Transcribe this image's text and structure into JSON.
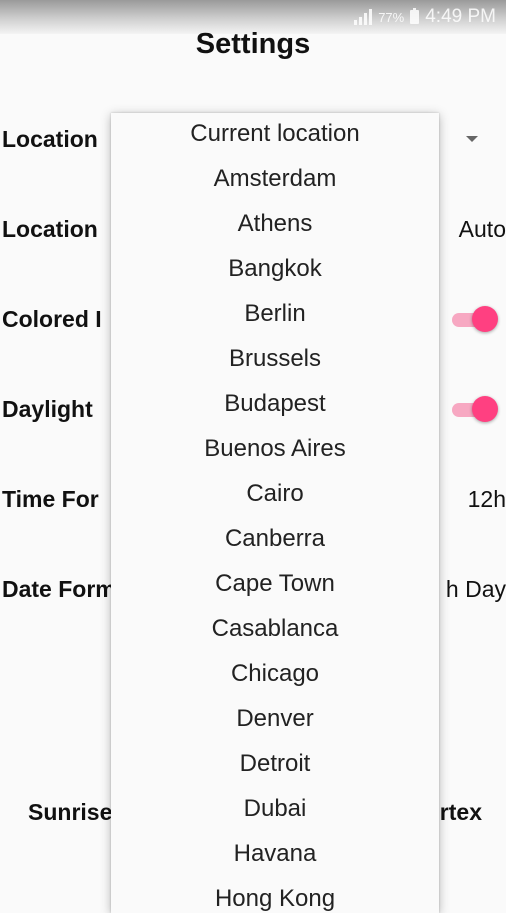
{
  "status_bar": {
    "battery_percent": "77%",
    "time": "4:49 PM",
    "icons": [
      "signal-icon",
      "battery-icon"
    ]
  },
  "title": "Settings",
  "settings": [
    {
      "label": "Location",
      "value": "",
      "control": "dropdown"
    },
    {
      "label": "Location",
      "value": "Auto",
      "control": "text"
    },
    {
      "label": "Colored I",
      "value": "",
      "control": "toggle",
      "on": true
    },
    {
      "label": "Daylight",
      "value": "",
      "control": "toggle",
      "on": true
    },
    {
      "label": "Time For",
      "value": "12h",
      "control": "text"
    },
    {
      "label": "Date Form",
      "value": "h Day",
      "control": "text"
    }
  ],
  "footer": {
    "left": "Sunrise",
    "right": "rtex"
  },
  "dropdown": {
    "options": [
      "Current location",
      "Amsterdam",
      "Athens",
      "Bangkok",
      "Berlin",
      "Brussels",
      "Budapest",
      "Buenos Aires",
      "Cairo",
      "Canberra",
      "Cape Town",
      "Casablanca",
      "Chicago",
      "Denver",
      "Detroit",
      "Dubai",
      "Havana",
      "Hong Kong"
    ]
  },
  "colors": {
    "accent": "#ff4081",
    "accent_track": "#f7a8c2",
    "background": "#fafafa"
  }
}
